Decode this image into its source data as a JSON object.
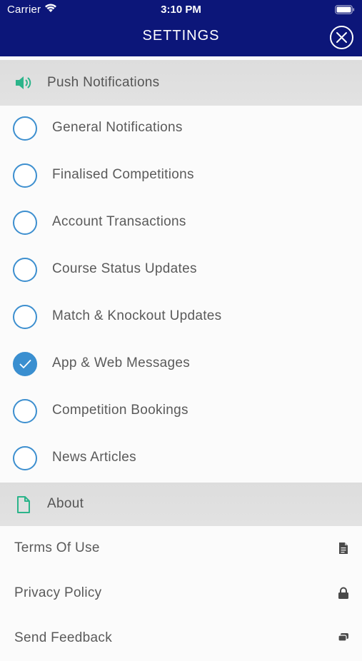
{
  "status_bar": {
    "carrier": "Carrier",
    "time": "3:10 PM",
    "wifi_icon": "wifi-icon",
    "battery_icon": "battery-icon"
  },
  "header": {
    "title": "SETTINGS",
    "close_icon": "close-icon"
  },
  "push_section": {
    "title": "Push Notifications",
    "icon": "speaker-icon",
    "items": [
      {
        "label": "General Notifications",
        "checked": false
      },
      {
        "label": "Finalised Competitions",
        "checked": false
      },
      {
        "label": "Account Transactions",
        "checked": false
      },
      {
        "label": "Course Status Updates",
        "checked": false
      },
      {
        "label": "Match & Knockout Updates",
        "checked": false
      },
      {
        "label": "App & Web Messages",
        "checked": true
      },
      {
        "label": "Competition Bookings",
        "checked": false
      },
      {
        "label": "News Articles",
        "checked": false
      }
    ]
  },
  "about_section": {
    "title": "About",
    "icon": "document-icon",
    "items": [
      {
        "label": "Terms Of Use",
        "icon": "document-icon"
      },
      {
        "label": "Privacy Policy",
        "icon": "lock-icon"
      },
      {
        "label": "Send Feedback",
        "icon": "chat-icon"
      }
    ]
  },
  "colors": {
    "header_bg": "#0c1679",
    "accent_blue": "#3a8fd0",
    "accent_green": "#2bb48a",
    "section_bg": "#dfdfdf"
  }
}
